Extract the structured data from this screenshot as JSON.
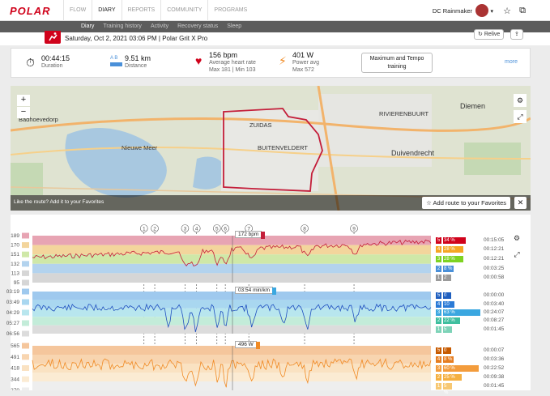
{
  "app": {
    "logo": "POLAR",
    "user": "DC Rainmaker"
  },
  "nav": [
    "FLOW",
    "DIARY",
    "REPORTS",
    "COMMUNITY",
    "PROGRAMS"
  ],
  "nav_active": 1,
  "subnav": [
    "Diary",
    "Training history",
    "Activity",
    "Recovery status",
    "Sleep"
  ],
  "subnav_active": 0,
  "session": {
    "title": "Saturday, Oct 2, 2021 03:06 PM | Polar Grit X Pro",
    "relive": "Relive"
  },
  "stats": {
    "duration_value": "00:44:15",
    "duration_label": "Duration",
    "distance_value": "9.51 km",
    "distance_label": "Distance",
    "distance_tag": "A B",
    "hr_value": "156 bpm",
    "hr_label": "Average heart rate",
    "hr_sub": "Max 181  |  Min 103",
    "power_value": "401 W",
    "power_label": "Power avg",
    "power_sub": "Max 572",
    "tag_line1": "Maximum and Tempo",
    "tag_line2": "training",
    "more": "more"
  },
  "map": {
    "labels": [
      "Badhoevedorp",
      "Nieuwe Meer",
      "ZUIDAS",
      "BUITENVELDERT",
      "RIVIERENBUURT",
      "Diemen",
      "Duivendrecht"
    ],
    "fav_text": "Like the route?  Add it to your Favorites",
    "fav_button": "Add route to your Favorites",
    "zoom_in": "+",
    "zoom_out": "−"
  },
  "laps": [
    "1",
    "2",
    "3",
    "4",
    "5",
    "6",
    "7",
    "8",
    "9"
  ],
  "lap_fracs": [
    0.28,
    0.307,
    0.383,
    0.412,
    0.463,
    0.484,
    0.543,
    0.683,
    0.807
  ],
  "hr": {
    "ticks": [
      "189",
      "170",
      "151",
      "132",
      "113",
      "95"
    ],
    "cursor": "172 bpm",
    "zones": [
      {
        "zone": "5",
        "pct": 34,
        "label": "34 %",
        "time": "00:15:05",
        "color": "#d0021b"
      },
      {
        "zone": "4",
        "pct": 28,
        "label": "28 %",
        "time": "00:12:21",
        "color": "#f5a623"
      },
      {
        "zone": "3",
        "pct": 28,
        "label": "28 %",
        "time": "00:12:21",
        "color": "#7ed321"
      },
      {
        "zone": "2",
        "pct": 8,
        "label": "8 %",
        "time": "00:03:25",
        "color": "#4a90d9"
      },
      {
        "zone": "1",
        "pct": 2,
        "label": "2 %",
        "time": "00:00:58",
        "color": "#9b9b9b"
      }
    ]
  },
  "speed": {
    "ticks": [
      "03:19",
      "03:49",
      "04:29",
      "05:27",
      "06:56"
    ],
    "cursor": "03:54 min/km",
    "zones": [
      {
        "zone": "5",
        "pct": 0,
        "label": "0 %",
        "time": "00:00:00",
        "color": "#1f5fbf"
      },
      {
        "zone": "4",
        "pct": 10,
        "label": "10 %",
        "time": "00:03:40",
        "color": "#2a7ad6"
      },
      {
        "zone": "3",
        "pct": 63,
        "label": "63 %",
        "time": "00:24:07",
        "color": "#3ba7e0"
      },
      {
        "zone": "2",
        "pct": 22,
        "label": "22 %",
        "time": "00:08:27",
        "color": "#3fbf9f"
      },
      {
        "zone": "1",
        "pct": 5,
        "label": "5 %",
        "time": "00:01:45",
        "color": "#7ed3b8"
      }
    ]
  },
  "power": {
    "ticks": [
      "565",
      "491",
      "418",
      "344",
      "270"
    ],
    "cursor": "496 W",
    "zones": [
      {
        "zone": "5",
        "pct": 0,
        "label": "0 %",
        "time": "00:00:07",
        "color": "#c75a00"
      },
      {
        "zone": "4",
        "pct": 8,
        "label": "8 %",
        "time": "00:03:36",
        "color": "#e67e22"
      },
      {
        "zone": "3",
        "pct": 60,
        "label": "60 %",
        "time": "00:22:52",
        "color": "#f39c3c"
      },
      {
        "zone": "2",
        "pct": 25,
        "label": "25 %",
        "time": "00:09:38",
        "color": "#f5b041"
      },
      {
        "zone": "1",
        "pct": 5,
        "label": "5 %",
        "time": "00:01:45",
        "color": "#f7c873"
      }
    ]
  },
  "colors": {
    "accent": "#d0021b",
    "link": "#4a90d9",
    "hr_line": "#c41e3a",
    "speed_line": "#1f4fbf",
    "power_line": "#f08a24"
  }
}
